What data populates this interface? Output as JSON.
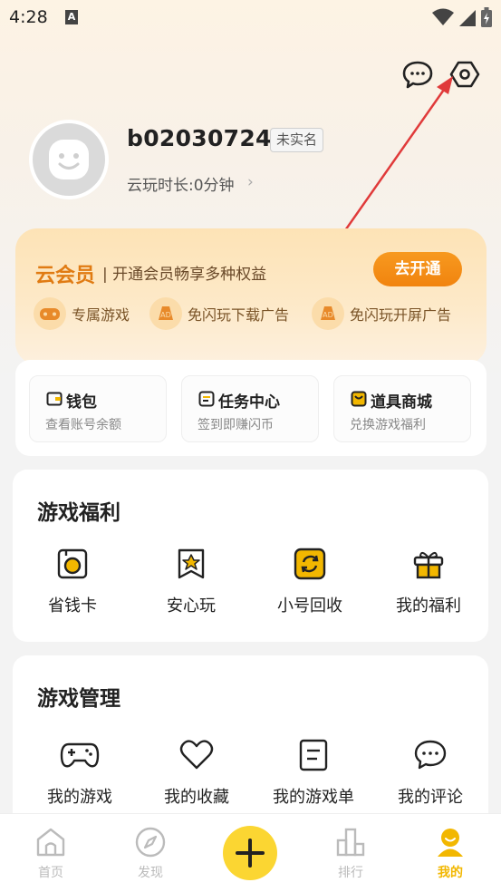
{
  "status": {
    "time": "4:28",
    "notif": "A"
  },
  "profile": {
    "username": "b020307247",
    "badge": "未实名",
    "playtime": "云玩时长:0分钟",
    "arrow": "›"
  },
  "vip": {
    "title": "云会员",
    "subtitle": "| 开通会员畅享多种权益",
    "button": "去开通",
    "perks": [
      {
        "label": "专属游戏",
        "icon": "gamepad-icon"
      },
      {
        "label": "免闪玩下载广告",
        "icon": "no-ad-icon"
      },
      {
        "label": "免闪玩开屏广告",
        "icon": "no-ad-icon"
      }
    ]
  },
  "wallet": [
    {
      "title": "钱包",
      "sub": "查看账号余额",
      "icon": "wallet-icon"
    },
    {
      "title": "任务中心",
      "sub": "签到即赚闪币",
      "icon": "task-icon"
    },
    {
      "title": "道具商城",
      "sub": "兑换游戏福利",
      "icon": "shop-icon"
    }
  ],
  "benefits": {
    "title": "游戏福利",
    "items": [
      {
        "label": "省钱卡",
        "icon": "save-card-icon"
      },
      {
        "label": "安心玩",
        "icon": "star-badge-icon"
      },
      {
        "label": "小号回收",
        "icon": "recycle-icon"
      },
      {
        "label": "我的福利",
        "icon": "gift-icon"
      }
    ]
  },
  "manage": {
    "title": "游戏管理",
    "items": [
      {
        "label": "我的游戏",
        "icon": "gamepad-icon"
      },
      {
        "label": "我的收藏",
        "icon": "heart-icon"
      },
      {
        "label": "我的游戏单",
        "icon": "list-icon"
      },
      {
        "label": "我的评论",
        "icon": "comment-icon"
      }
    ]
  },
  "nav": [
    {
      "label": "首页",
      "icon": "home-icon",
      "active": false
    },
    {
      "label": "发现",
      "icon": "compass-icon",
      "active": false
    },
    {
      "label": "排行",
      "icon": "rank-icon",
      "active": false
    },
    {
      "label": "我的",
      "icon": "profile-icon",
      "active": true
    }
  ],
  "colors": {
    "accent": "#F2B700",
    "vip_orange": "#F1840F",
    "fab": "#FBD632"
  }
}
